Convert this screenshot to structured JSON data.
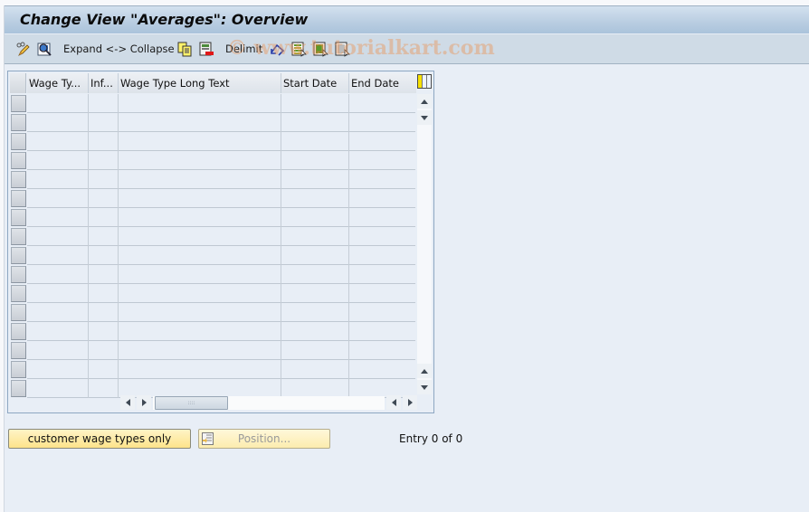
{
  "window": {
    "title": "Change View \"Averages\": Overview"
  },
  "toolbar": {
    "items": [
      {
        "name": "display-change-icon",
        "label": ""
      },
      {
        "name": "details-icon",
        "label": ""
      },
      {
        "name": "expand-collapse",
        "label": "Expand <-> Collapse"
      },
      {
        "name": "copy-as-icon",
        "label": ""
      },
      {
        "name": "delete-icon",
        "label": ""
      },
      {
        "name": "delimit",
        "label": "Delimit"
      },
      {
        "name": "undo-change-icon",
        "label": ""
      },
      {
        "name": "select-all-icon",
        "label": ""
      },
      {
        "name": "select-block-icon",
        "label": ""
      },
      {
        "name": "deselect-all-icon",
        "label": ""
      }
    ],
    "watermark": "© www.tutorialkart.com"
  },
  "table": {
    "columns": [
      {
        "label": "Wage Ty..."
      },
      {
        "label": "Inf..."
      },
      {
        "label": "Wage Type Long Text"
      },
      {
        "label": "Start Date"
      },
      {
        "label": "End Date"
      }
    ],
    "rows": [
      [
        "",
        "",
        "",
        "",
        ""
      ],
      [
        "",
        "",
        "",
        "",
        ""
      ],
      [
        "",
        "",
        "",
        "",
        ""
      ],
      [
        "",
        "",
        "",
        "",
        ""
      ],
      [
        "",
        "",
        "",
        "",
        ""
      ],
      [
        "",
        "",
        "",
        "",
        ""
      ],
      [
        "",
        "",
        "",
        "",
        ""
      ],
      [
        "",
        "",
        "",
        "",
        ""
      ],
      [
        "",
        "",
        "",
        "",
        ""
      ],
      [
        "",
        "",
        "",
        "",
        ""
      ],
      [
        "",
        "",
        "",
        "",
        ""
      ],
      [
        "",
        "",
        "",
        "",
        ""
      ],
      [
        "",
        "",
        "",
        "",
        ""
      ],
      [
        "",
        "",
        "",
        "",
        ""
      ],
      [
        "",
        "",
        "",
        "",
        ""
      ],
      [
        "",
        "",
        "",
        "",
        ""
      ]
    ],
    "hscroll_thumb_grip": "::::"
  },
  "buttons": {
    "customer_wage_types": "customer wage types only",
    "position": "Position..."
  },
  "status": {
    "entry": "Entry 0 of 0"
  },
  "colors": {
    "titlebar": "#b9cde1",
    "toolbar": "#cfdbe6",
    "background": "#e8eef6",
    "button_yellow": "#fde38a"
  }
}
